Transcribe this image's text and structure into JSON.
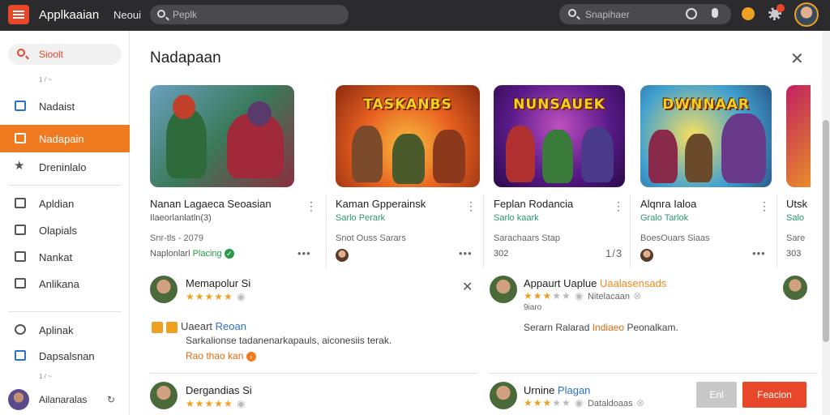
{
  "topbar": {
    "app_title": "Applkaaian",
    "nav_link": "Neoui",
    "search_placeholder": "Peplk",
    "search2_placeholder": "Snapihaer"
  },
  "sidebar": {
    "search_label": "Sioolt",
    "note1": "1 / ~",
    "items": [
      {
        "label": "Nadaist",
        "icon": "calendar-icon"
      },
      {
        "label": "Nadapain",
        "icon": "briefcase-icon",
        "active": true
      },
      {
        "label": "Dreninlalo",
        "icon": "star-icon"
      },
      {
        "label": "Apldian",
        "icon": "list-icon"
      },
      {
        "label": "Olapials",
        "icon": "bars-icon"
      },
      {
        "label": "Nankat",
        "icon": "mail-icon"
      },
      {
        "label": "Anlikana",
        "icon": "folder-icon"
      },
      {
        "label": "Aplinak",
        "icon": "gear-icon"
      },
      {
        "label": "Dapsalsnan",
        "icon": "grid-icon"
      }
    ],
    "note2": "1 / ~",
    "user_label": "Ailanaralas"
  },
  "main": {
    "title": "Nadapaan",
    "cards": [
      {
        "thumb_title": "",
        "name": "Nanan Lagaeca Seoasian",
        "sub": "Ilaeorlanlatln(3)",
        "meta": "Snr-tls - 2079",
        "foot": "Naplonlarl",
        "foot_hl": "Placing",
        "colors": [
          "#3a8a5a",
          "#b04030"
        ]
      },
      {
        "thumb_title": "TASKANBS",
        "name": "Kaman Gpperainsk",
        "sub": "Sarlo Perark",
        "meta": "Snot Ouss Sarars",
        "foot": "",
        "foot_hl": "",
        "colors": [
          "#f08020",
          "#c03010"
        ]
      },
      {
        "thumb_title": "NUNSAUEK",
        "name": "Feplan Rodancia",
        "sub": "Sarlo kaark",
        "meta": "Sarachaars Stap",
        "foot": "302",
        "foot_right": "1/3",
        "foot_hl": "",
        "colors": [
          "#6a2ab0",
          "#e04020"
        ]
      },
      {
        "thumb_title": "DWNNAAR",
        "name": "Alqnra Ialoa",
        "sub": "Gralo Tarlok",
        "meta": "BoesOuars Siaas",
        "foot": "",
        "foot_hl": "",
        "colors": [
          "#2a9ad0",
          "#e8a020"
        ]
      },
      {
        "thumb_title": "",
        "name": "Utsk",
        "sub": "Salo",
        "meta": "Sare",
        "foot": "303",
        "foot_hl": "",
        "colors": [
          "#c02060",
          "#f0a020"
        ]
      }
    ],
    "reviews": [
      {
        "name": "Memapolur",
        "suffix": "Si",
        "stars": "★★★★★",
        "text_badge": "Uaeart",
        "text_badge_blue": "Reoan",
        "body": "Sarkalionse tadanenarkapauls, aiconesiis terak.",
        "link": "Rao thao kan"
      },
      {
        "name": "Appaurt Uaplue",
        "suffix_hl": "Uaalasensads",
        "stars": "★★★",
        "stars_gray": "★★",
        "note": "Nitelacaan",
        "sub": "9iaro",
        "body": "Serarn Ralarad",
        "body_hl": "Indiaeo",
        "body_end": "Peonalkam."
      },
      {
        "name": "Dergandias",
        "suffix": "Si",
        "stars": "★★★★★"
      },
      {
        "name": "Urnine",
        "suffix_hl": "Plagan",
        "stars": "★★★",
        "stars_gray": "★★",
        "note": "Dataldoaas"
      }
    ],
    "btn_secondary": "Enl",
    "btn_primary": "Feacion"
  }
}
